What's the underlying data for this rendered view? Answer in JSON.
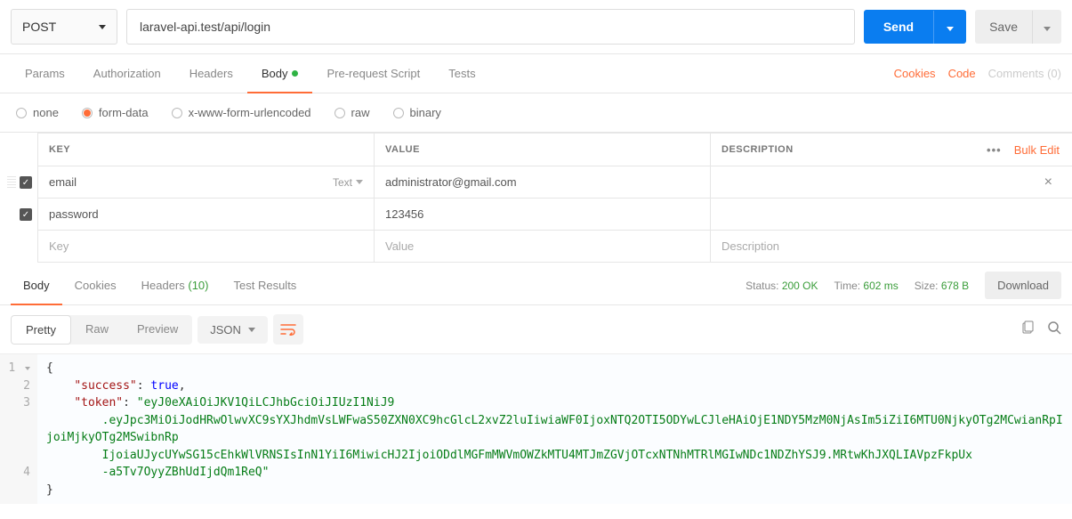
{
  "top": {
    "method": "POST",
    "url": "laravel-api.test/api/login",
    "send": "Send",
    "save": "Save"
  },
  "reqTabs": {
    "params": "Params",
    "authorization": "Authorization",
    "headers": "Headers",
    "body": "Body",
    "prerequest": "Pre-request Script",
    "tests": "Tests",
    "cookies": "Cookies",
    "code": "Code",
    "comments": "Comments (0)"
  },
  "bodyTypes": {
    "none": "none",
    "formdata": "form-data",
    "xwww": "x-www-form-urlencoded",
    "raw": "raw",
    "binary": "binary"
  },
  "kv": {
    "headKey": "KEY",
    "headValue": "VALUE",
    "headDesc": "DESCRIPTION",
    "bulkEdit": "Bulk Edit",
    "typeBadge": "Text",
    "row1": {
      "key": "email",
      "value": "administrator@gmail.com"
    },
    "row2": {
      "key": "password",
      "value": "123456"
    },
    "placeholderKey": "Key",
    "placeholderValue": "Value",
    "placeholderDesc": "Description"
  },
  "respTabs": {
    "body": "Body",
    "cookies": "Cookies",
    "headers": "Headers",
    "headersCount": "(10)",
    "testResults": "Test Results",
    "statusLabel": "Status:",
    "statusValue": "200 OK",
    "timeLabel": "Time:",
    "timeValue": "602 ms",
    "sizeLabel": "Size:",
    "sizeValue": "678 B",
    "download": "Download"
  },
  "viewBar": {
    "pretty": "Pretty",
    "raw": "Raw",
    "preview": "Preview",
    "json": "JSON"
  },
  "response": {
    "successKey": "\"success\"",
    "successVal": "true",
    "tokenKey": "\"token\"",
    "tokenHead": "\"eyJ0eXAiOiJKV1QiLCJhbGciOiJIUzI1NiJ9",
    "tokenL2": ".eyJpc3MiOiJodHRwOlwvXC9sYXJhdmVsLWFwaS50ZXN0XC9hcGlcL2xvZ2luIiwiaWF0IjoxNTQ2OTI5ODYwLCJleHAiOjE1NDY5MzM0NjAsIm5iZiI6MTU0NjkyOTg2MCwianRpIjoiMjkyOTg2MSwibnRp",
    "tokenL3": "IjoiaUJycUYwSG15cEhkWlVRNSIsInN1YiI6MiwicHJ2IjoiODdlMGFmMWVmOWZkMTU4MTJmZGVjOTcxNTNhMTRlMGIwNDc1NDZhYSJ9.MRtwKhJXQLIAVpzFkpUx",
    "tokenL4": "-a5Tv7OyyZBhUdIjdQm1ReQ\""
  }
}
